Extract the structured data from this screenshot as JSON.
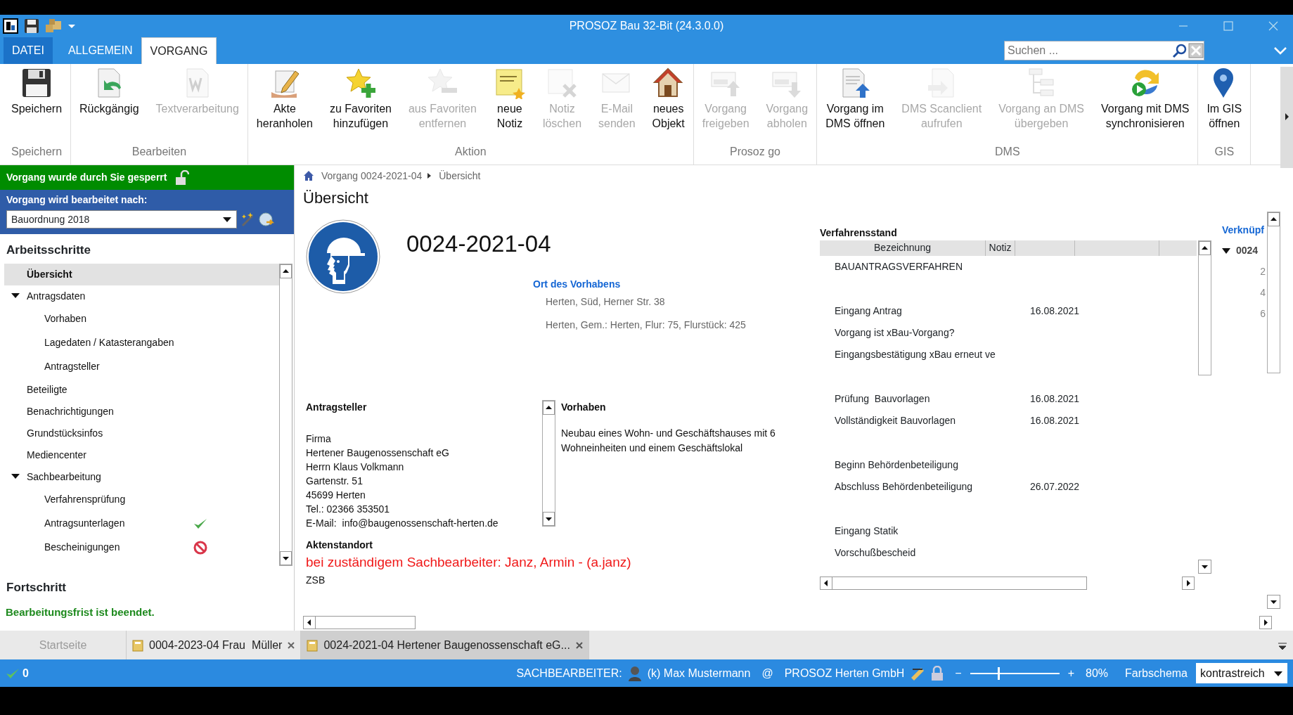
{
  "window": {
    "title": "PROSOZ Bau 32-Bit (24.3.0.0)"
  },
  "ribbon_tabs": [
    {
      "label": "DATEI",
      "kind": "file",
      "selected": false
    },
    {
      "label": "ALLGEMEIN",
      "kind": "tab",
      "selected": false
    },
    {
      "label": "VORGANG",
      "kind": "tab",
      "selected": true
    }
  ],
  "search": {
    "placeholder": "Suchen ..."
  },
  "ribbon_groups": [
    {
      "label": "Speichern",
      "buttons": [
        {
          "lines": [
            "Speichern"
          ],
          "disabled": false
        }
      ]
    },
    {
      "label": "Bearbeiten",
      "buttons": [
        {
          "lines": [
            "Rückgängig"
          ],
          "disabled": false
        },
        {
          "lines": [
            "Textverarbeitung"
          ],
          "disabled": true
        }
      ]
    },
    {
      "label": "Aktion",
      "buttons": [
        {
          "lines": [
            "Akte",
            "heranholen"
          ],
          "disabled": false
        },
        {
          "lines": [
            "zu Favoriten",
            "hinzufügen"
          ],
          "disabled": false
        },
        {
          "lines": [
            "aus Favoriten",
            "entfernen"
          ],
          "disabled": true
        },
        {
          "lines": [
            "neue",
            "Notiz"
          ],
          "disabled": false
        },
        {
          "lines": [
            "Notiz",
            "löschen"
          ],
          "disabled": true
        },
        {
          "lines": [
            "E-Mail",
            "senden"
          ],
          "disabled": true
        },
        {
          "lines": [
            "neues",
            "Objekt"
          ],
          "disabled": false
        }
      ]
    },
    {
      "label": "Prosoz go",
      "buttons": [
        {
          "lines": [
            "Vorgang",
            "freigeben"
          ],
          "disabled": true
        },
        {
          "lines": [
            "Vorgang",
            "abholen"
          ],
          "disabled": true
        }
      ]
    },
    {
      "label": "DMS",
      "buttons": [
        {
          "lines": [
            "Vorgang im",
            "DMS öffnen"
          ],
          "disabled": false
        },
        {
          "lines": [
            "DMS Scanclient",
            "aufrufen"
          ],
          "disabled": true
        },
        {
          "lines": [
            "Vorgang an DMS",
            "übergeben"
          ],
          "disabled": true
        },
        {
          "lines": [
            "Vorgang mit DMS",
            "synchronisieren"
          ],
          "disabled": false
        }
      ]
    },
    {
      "label": "GIS",
      "buttons": [
        {
          "lines": [
            "Im GIS",
            "öffnen"
          ],
          "disabled": false
        }
      ]
    }
  ],
  "sidebar": {
    "lock_banner": "Vorgang wurde durch Sie gesperrt",
    "rule_label": "Vorgang wird bearbeitet nach:",
    "rule_value": "Bauordnung 2018",
    "steps_title": "Arbeitsschritte",
    "steps": [
      {
        "label": "Übersicht",
        "selected": true
      },
      {
        "label": "Antragsdaten",
        "selected": false,
        "expanded": true,
        "children": [
          {
            "label": "Vorhaben",
            "selected": false
          },
          {
            "label": "Lagedaten / Katasterangaben",
            "selected": false
          },
          {
            "label": "Antragsteller",
            "selected": false
          }
        ]
      },
      {
        "label": "Beteiligte",
        "selected": false
      },
      {
        "label": "Benachrichtigungen",
        "selected": false
      },
      {
        "label": "Grundstücksinfos",
        "selected": false
      },
      {
        "label": "Mediencenter",
        "selected": false
      },
      {
        "label": "Sachbearbeitung",
        "selected": false,
        "expanded": true,
        "children": [
          {
            "label": "Verfahrensprüfung",
            "selected": false,
            "done": false,
            "blocked": false
          },
          {
            "label": "Antragsunterlagen",
            "selected": false,
            "done": true,
            "blocked": false
          },
          {
            "label": "Bescheinigungen",
            "selected": false,
            "done": false,
            "blocked": true
          }
        ]
      }
    ],
    "progress_title": "Fortschritt",
    "progress_text": "Bearbeitungsfrist ist beendet."
  },
  "breadcrumb": [
    "Vorgang 0024-2021-04",
    "Übersicht"
  ],
  "page_title": "Übersicht",
  "case_number": "0024-2021-04",
  "location": {
    "heading": "Ort des Vorhabens",
    "lines": [
      "Herten, Süd, Herner Str. 38",
      "Herten, Gem.: Herten, Flur: 75, Flurstück: 425"
    ]
  },
  "applicant": {
    "heading": "Antragsteller",
    "lines": [
      "Firma",
      "Hertener Baugenossenschaft eG",
      "Herrn Klaus Volkmann",
      "Gartenstr. 51",
      "45699 Herten",
      "Tel.: 02366 353501"
    ],
    "email_label": "E-Mail:",
    "email": "info@baugenossenschaft-herten.de"
  },
  "project": {
    "heading": "Vorhaben",
    "text": "Neubau eines Wohn- und Geschäftshauses mit 6 Wohneinheiten und einem Geschäftslokal"
  },
  "file_location": {
    "heading": "Aktenstandort",
    "value": "bei zuständigem Sachbearbeiter: Janz, Armin - (a.janz)",
    "unit": "ZSB"
  },
  "procedure": {
    "title": "Verfahrensstand",
    "columns": [
      "Bezeichnung",
      "Notiz"
    ],
    "groups": [
      [
        {
          "label": "BAUANTRAGSVERFAHREN"
        }
      ],
      [
        {
          "label": "Eingang Antrag",
          "date": "16.08.2021"
        },
        {
          "label": "Vorgang ist xBau-Vorgang?"
        },
        {
          "label": "Eingangsbestätigung xBau erneut ve"
        }
      ],
      [
        {
          "label": "Prüfung  Bauvorlagen",
          "date": "16.08.2021"
        },
        {
          "label": "Vollständigkeit Bauvorlagen",
          "date": "16.08.2021"
        }
      ],
      [
        {
          "label": "Beginn Behördenbeteiligung"
        },
        {
          "label": "Abschluss Behördenbeteiligung",
          "date": "26.07.2022"
        }
      ],
      [
        {
          "label": "Eingang Statik"
        },
        {
          "label": "Vorschußbescheid"
        }
      ]
    ]
  },
  "links": {
    "title": "Verknüpf",
    "item": {
      "label": "0024",
      "expanded": true,
      "children": [
        "2",
        "4",
        "6"
      ]
    }
  },
  "doc_tabs": [
    {
      "label": "Startseite",
      "selected": false,
      "closable": false,
      "disabled": true
    },
    {
      "label": "0004-2023-04 Frau  Müller",
      "selected": false,
      "closable": true,
      "disabled": false
    },
    {
      "label": "0024-2021-04 Hertener Baugenossenschaft eG...",
      "selected": true,
      "closable": true,
      "disabled": false
    }
  ],
  "status_bar": {
    "count": "0",
    "role_label": "SACHBEARBEITER:",
    "user": "(k) Max Mustermann",
    "at": "@",
    "org": "PROSOZ Herten GmbH",
    "zoom_minus": "−",
    "zoom_plus": "+",
    "level": 0.31,
    "zoom": "80%",
    "scheme_label": "Farbschema",
    "scheme": "kontrastreich"
  }
}
